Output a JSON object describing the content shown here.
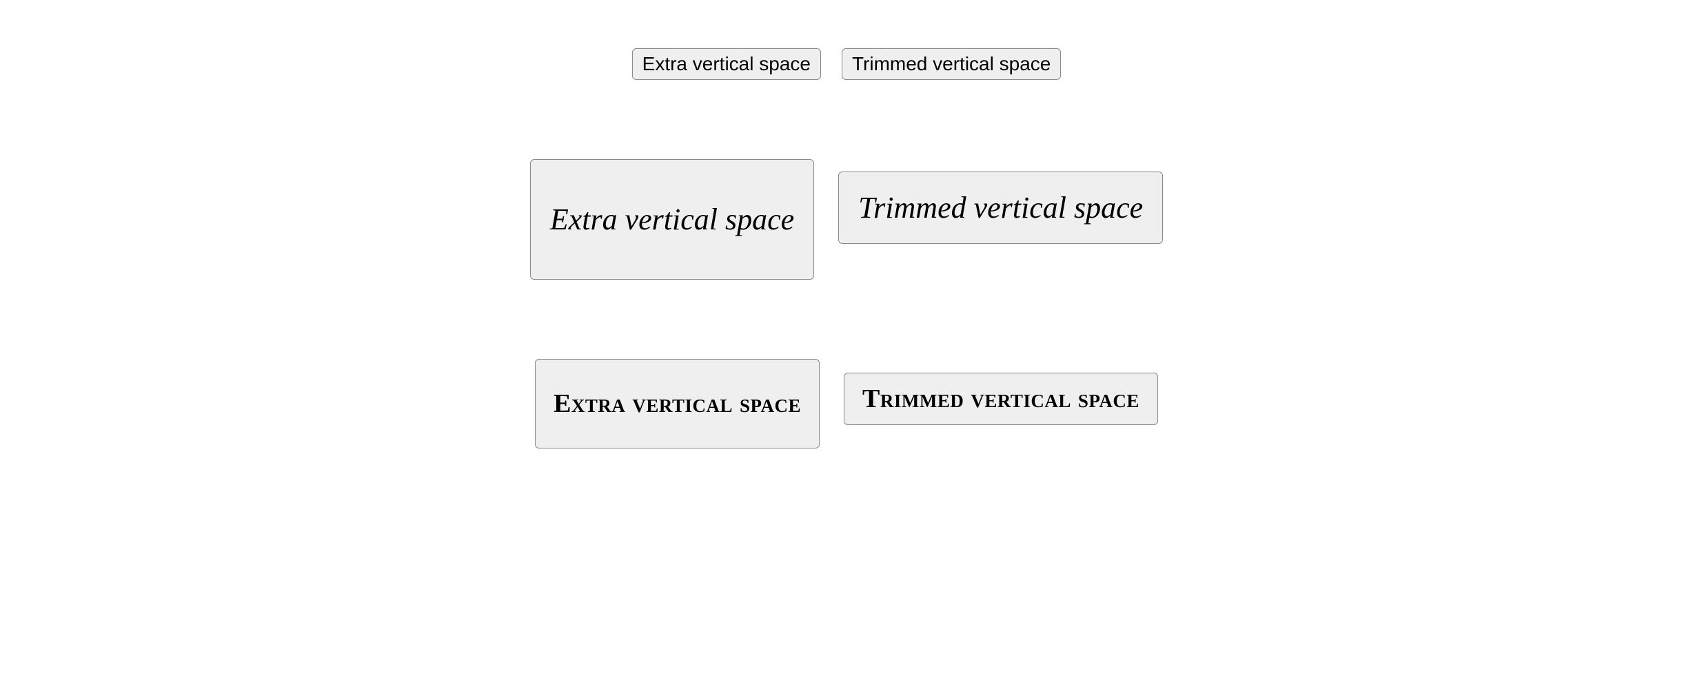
{
  "row1": {
    "extra": "Extra vertical space",
    "trimmed": "Trimmed vertical space"
  },
  "row2": {
    "extra": "Extra vertical space",
    "trimmed": "Trimmed vertical space"
  },
  "row3": {
    "extra": "Extra vertical space",
    "trimmed": "Trimmed vertical space"
  }
}
